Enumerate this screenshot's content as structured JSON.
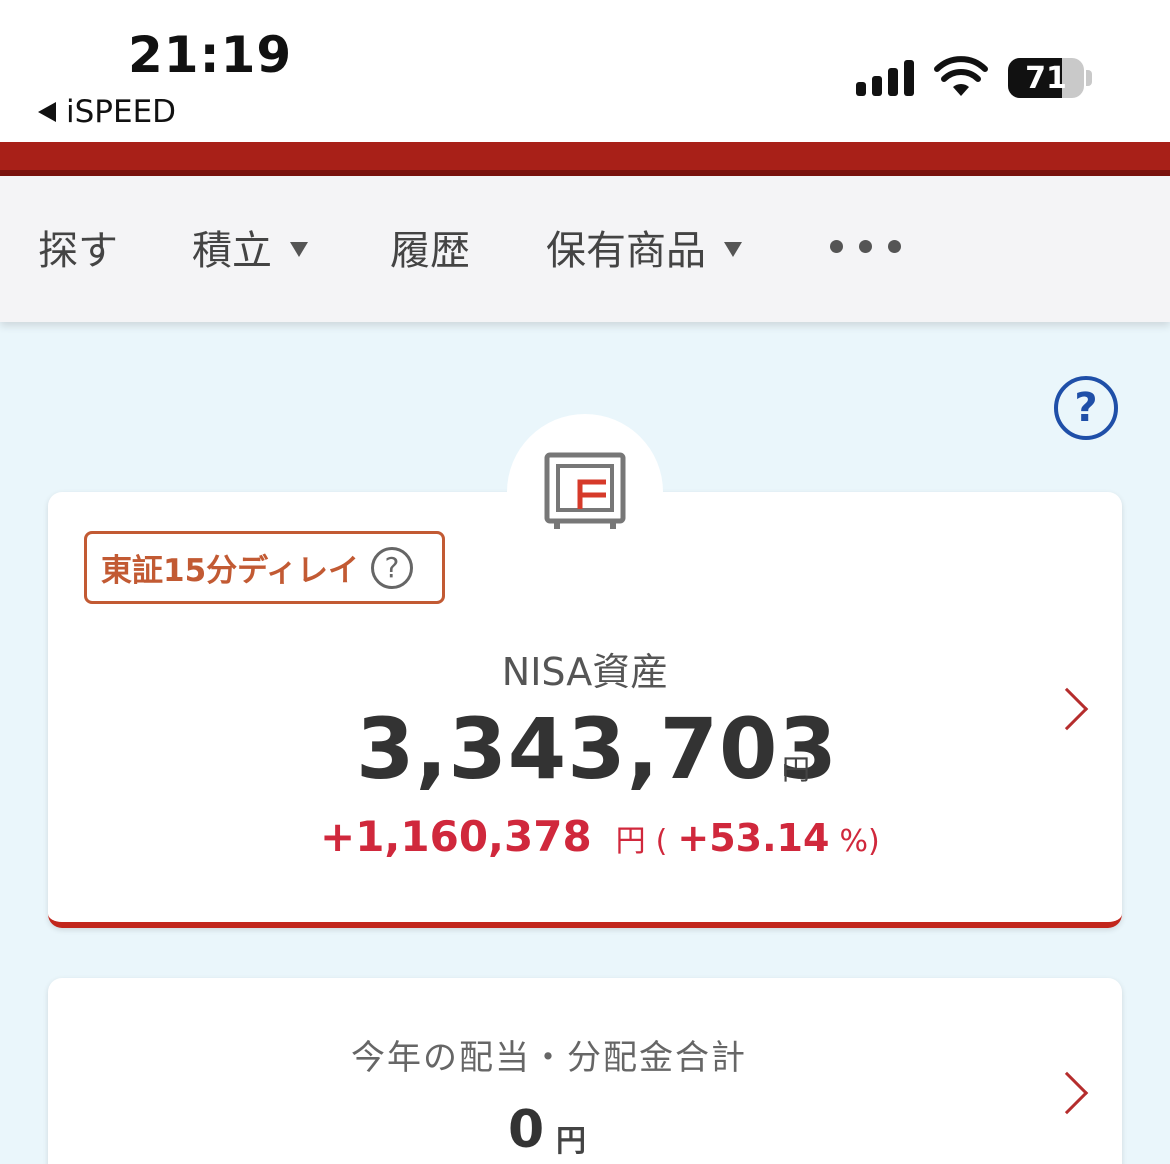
{
  "status_bar": {
    "time": "21:19",
    "back_app": "iSPEED",
    "battery_percent": 71
  },
  "nav": {
    "items": [
      {
        "label": "探す",
        "has_caret": false
      },
      {
        "label": "積立",
        "has_caret": true
      },
      {
        "label": "履歴",
        "has_caret": false
      },
      {
        "label": "保有商品",
        "has_caret": true
      }
    ],
    "more_icon": "ellipsis-icon"
  },
  "help_icon": "?",
  "nisa_card": {
    "delay_badge": "東証15分ディレイ",
    "delay_help": "?",
    "title": "NISA資産",
    "value": "3,343,703",
    "unit": "円",
    "gain_amount": "+1,160,378",
    "gain_unit": "円",
    "paren_open": "(",
    "gain_percent": "+53.14",
    "paren_close": "%)"
  },
  "dividend_card": {
    "title": "今年の配当・分配金合計",
    "value": "0",
    "unit": "円"
  },
  "colors": {
    "brand_red": "#a82018",
    "gain_red": "#d0283c",
    "badge_orange": "#c25a33",
    "help_blue": "#1f4fa8",
    "background": "#eaf6fb"
  }
}
